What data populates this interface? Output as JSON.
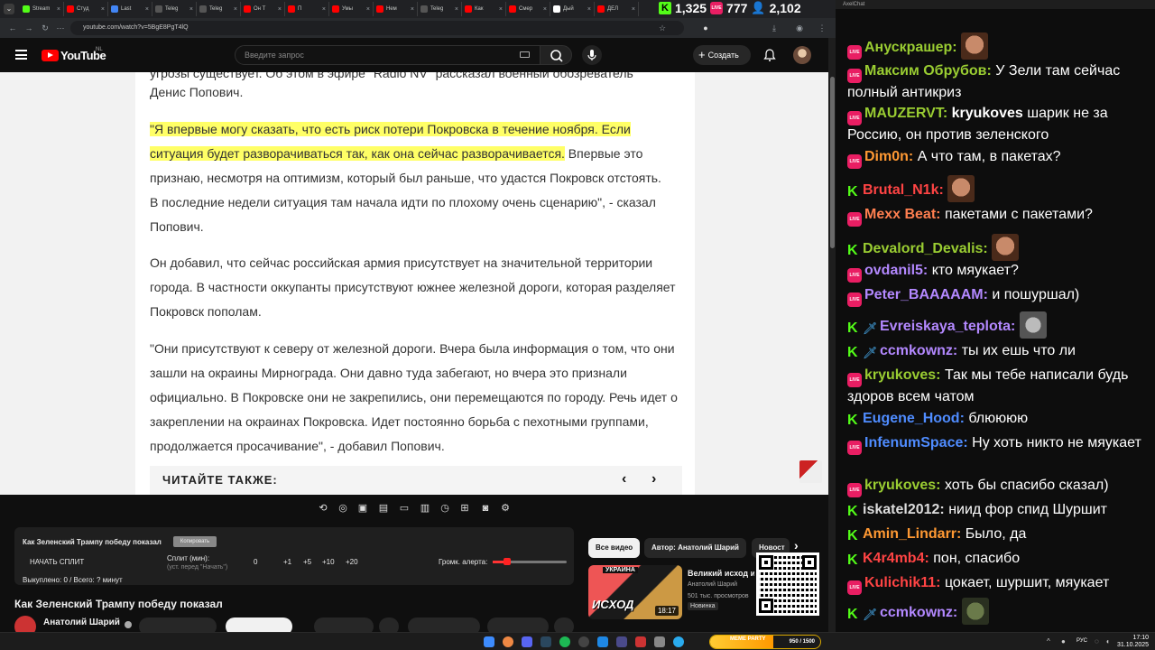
{
  "browser": {
    "tabs": [
      {
        "label": "Stream",
        "color": "#53fc18"
      },
      {
        "label": "Студ",
        "color": "#ff0000"
      },
      {
        "label": "Last",
        "color": "#4285f4"
      },
      {
        "label": "Teleg",
        "color": "#555555"
      },
      {
        "label": "Teleg",
        "color": "#555555"
      },
      {
        "label": "Он Т",
        "color": "#ff0000"
      },
      {
        "label": "П",
        "color": "#ff0000"
      },
      {
        "label": "Умы",
        "color": "#ff0000"
      },
      {
        "label": "Нем",
        "color": "#ff0000"
      },
      {
        "label": "Teleg",
        "color": "#555555"
      },
      {
        "label": "Как",
        "color": "#ff0000"
      },
      {
        "label": "Смер",
        "color": "#ff0000"
      },
      {
        "label": "Дый",
        "color": "#ffffff"
      },
      {
        "label": "ДЕЛ",
        "color": "#ff0000"
      }
    ],
    "url": "youtube.com/watch?v=5BgE8PgT4lQ"
  },
  "overlay": {
    "kick_count": "1,325",
    "live_count": "777",
    "viewers": "2,102"
  },
  "youtube": {
    "logo": "YouTube",
    "region": "NL",
    "search_placeholder": "Введите запрос",
    "create_label": "Создать"
  },
  "article": {
    "top_fragment": "угрозы существует. Об этом в эфире \"Radio NV\" рассказал военный обозреватель",
    "p1_line2": "Денис Попович.",
    "quote_highlight_1": "\"Я впервые могу сказать, что есть риск потери Покровска в течение ноября. Если",
    "quote_highlight_2": "ситуация будет разворачиваться так, как она сейчас разворачивается.",
    "quote_rest_2": " Впервые это",
    "quote_line3": "признаю, несмотря на оптимизм, который был раньше, что удастся Покровск отстоять.",
    "quote_line4": "В последние недели ситуация там начала идти по плохому очень сценарию\", - сказал",
    "quote_line5": "Попович.",
    "p3": "Он добавил, что сейчас российская армия присутствует на значительной территории города. В частности оккупанты присутствуют южнее железной дороги, которая разделяет Покровск пополам.",
    "p4": "\"Они присутствуют к северу от железной дороги. Вчера была информация о том, что они зашли на окраины Мирнограда. Они давно туда забегают, но вчера это признали официально. В Покровске они не закрепились, они перемещаются по городу. Речь идет о закреплении на окраинах Покровска. Идет постоянно борьба с пехотными группами, продолжается просачивание\", - добавил Попович.",
    "read_also": "ЧИТАЙТЕ ТАКЖЕ:"
  },
  "split_panel": {
    "title": "Как Зеленский Трампу победу показал",
    "copy_btn": "Копировать",
    "start_btn": "НАЧАТЬ СПЛИТ",
    "split_label": "Сплит (мин):",
    "split_hint": "(уст. перед \"Начать\")",
    "amounts": [
      "0",
      "+1",
      "+5",
      "+10",
      "+20"
    ],
    "alert_volume_label": "Громк. алерта:",
    "alert_volume": 0.2,
    "paid": "Выкуплено: 0 / Всего: ? минут"
  },
  "video": {
    "title": "Как Зеленский Трампу победу показал",
    "channel": "Анатолий Шарий"
  },
  "recommendations": {
    "chips": [
      "Все видео",
      "Автор: Анатолий Шарий",
      "Новост"
    ],
    "item": {
      "title": "Великий исход из",
      "channel": "Анатолий Шарий",
      "views": "501 тыс. просмотров",
      "badge": "Новинка",
      "duration": "18:17",
      "thumb_top": "УКРАИНА",
      "thumb_text": "ИСХОД"
    }
  },
  "chat": {
    "title": "AxelChat",
    "messages": [
      {
        "badge": "live",
        "user": "Анускрашер:",
        "color": "#9acd32",
        "text": "",
        "emote": "face"
      },
      {
        "badge": "live",
        "user": "Максим Обрубов:",
        "color": "#9acd32",
        "text": "У Зели там сейчас полный антикриз"
      },
      {
        "badge": "live",
        "user": "MAUZERVT:",
        "color": "#9acd32",
        "mention": "kryukoves",
        "text": "шарик не за Россию, он против зеленского"
      },
      {
        "badge": "live",
        "user": "Dim0n:",
        "color": "#ff9933",
        "text": "А что там, в пакетах?"
      },
      {
        "badge": "kick",
        "user": "Brutal_N1k:",
        "color": "#ff4444",
        "text": "",
        "emote": "face"
      },
      {
        "badge": "live",
        "user": "Mexx Beat:",
        "color": "#ff7f50",
        "text": "пакетами с пакетами?"
      },
      {
        "badge": "kick",
        "user": "Devalord_Devalis:",
        "color": "#9acd32",
        "text": "",
        "emote": "face"
      },
      {
        "badge": "live",
        "user": "ovdanil5:",
        "color": "#b388ff",
        "text": "кто мяукает?"
      },
      {
        "badge": "live",
        "user": "Peter_BAAAAAM:",
        "color": "#b388ff",
        "text": "и пошуршал)"
      },
      {
        "badge": "kick-sword",
        "user": "Evreiskaya_teplota:",
        "color": "#b388ff",
        "text": "",
        "emote": "cat"
      },
      {
        "badge": "kick-sword",
        "user": "ccmkownz:",
        "color": "#b388ff",
        "text": "ты их ешь что ли"
      },
      {
        "badge": "live",
        "user": "kryukoves:",
        "color": "#9acd32",
        "text": "Так мы тебе написали будь здоров всем чатом"
      },
      {
        "badge": "kick",
        "user": "Eugene_Hood:",
        "color": "#4f8cff",
        "text": "блюююю"
      },
      {
        "badge": "live",
        "user": "InfenumSpace:",
        "color": "#4f8cff",
        "text": "Ну хоть никто не мяукает"
      },
      {
        "badge": "live",
        "user": "kryukoves:",
        "color": "#9acd32",
        "text": "хоть бы спасибо сказал)"
      },
      {
        "badge": "kick",
        "user": "iskatel2012:",
        "color": "#dddddd",
        "text": "ниид фор спид Шуршит"
      },
      {
        "badge": "kick",
        "user": "Amin_Lindarr:",
        "color": "#ff9933",
        "text": "Было, да"
      },
      {
        "badge": "kick",
        "user": "K4r4mb4:",
        "color": "#ff4444",
        "text": "пон, спасибо"
      },
      {
        "badge": "live",
        "user": "Kulichik11:",
        "color": "#ff4444",
        "text": "цокает, шуршит, мяукает"
      },
      {
        "badge": "kick-sword",
        "user": "ccmkownz:",
        "color": "#b388ff",
        "text": "",
        "emote": "frog"
      }
    ]
  },
  "taskbar": {
    "meme_label": "MEME PARTY",
    "meme_count": "950 / 1500",
    "lang": "РУС",
    "time": "17:10",
    "date": "31.10.2025"
  }
}
